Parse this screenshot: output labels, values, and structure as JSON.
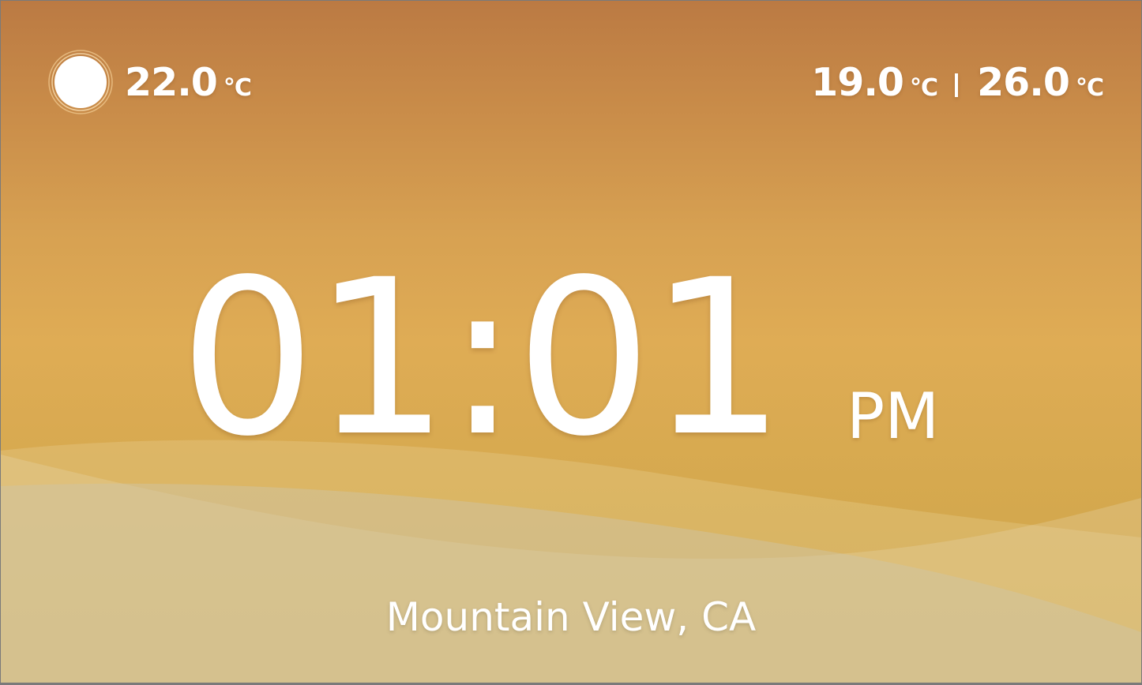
{
  "weather": {
    "icon": "sun-icon",
    "current_temp": "22.0",
    "current_unit": "°C",
    "low_temp": "19.0",
    "low_unit": "°C",
    "high_temp": "26.0",
    "high_unit": "°C"
  },
  "clock": {
    "time": "01:01",
    "meridiem": "PM"
  },
  "location": {
    "name": "Mountain View, CA"
  },
  "colors": {
    "sky_top": "#bb7a43",
    "sky_mid": "#dfac55",
    "sky_bottom": "#cca548",
    "ground": "#c5bb95",
    "text": "#ffffff"
  }
}
